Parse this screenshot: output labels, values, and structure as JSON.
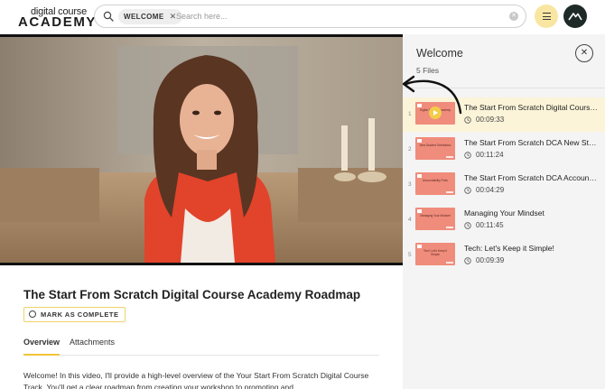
{
  "header": {
    "logo_small": "digital course",
    "logo_big": "ACADEMY",
    "search_chip": "WELCOME",
    "search_placeholder": "Search here..."
  },
  "main": {
    "lesson_title": "The Start From Scratch Digital Course Academy Roadmap",
    "complete_label": "MARK AS COMPLETE",
    "tabs": [
      {
        "label": "Overview",
        "active": true
      },
      {
        "label": "Attachments",
        "active": false
      }
    ],
    "overview_text": "Welcome! In this video, I'll provide a high-level overview of the Your Start From Scratch Digital Course Track. You'll get a clear roadmap from creating your workshop to promoting and"
  },
  "panel": {
    "title": "Welcome",
    "count": "5 Files",
    "items": [
      {
        "num": "1",
        "title": "The Start From Scratch Digital Course Academy Roadmap",
        "duration": "00:09:33",
        "thumb": "Digital Course Academy Roadmap",
        "active": true
      },
      {
        "num": "2",
        "title": "The Start From Scratch DCA New Student Orientation",
        "duration": "00:11:24",
        "thumb": "New Student Orientation",
        "active": false
      },
      {
        "num": "3",
        "title": "The Start From Scratch DCA Accountability Pods",
        "duration": "00:04:29",
        "thumb": "Accountability Pods",
        "active": false
      },
      {
        "num": "4",
        "title": "Managing Your Mindset",
        "duration": "00:11:45",
        "thumb": "Managing Your Mindset",
        "active": false
      },
      {
        "num": "5",
        "title": "Tech: Let's Keep it Simple!",
        "duration": "00:09:39",
        "thumb": "Tech: Let's Keep it Simple",
        "active": false
      }
    ]
  },
  "colors": {
    "accent_yellow": "#f8e6a2",
    "border_yellow": "#f0d36a",
    "thumb_coral": "#f08c7c",
    "active_row": "#fbf4d8",
    "avatar_dark": "#1d2a28"
  },
  "icons": {
    "search": "search-icon",
    "menu": "hamburger-menu-icon",
    "avatar": "mountain-logo-icon",
    "close": "close-icon",
    "clock": "clock-icon",
    "play": "play-icon"
  }
}
